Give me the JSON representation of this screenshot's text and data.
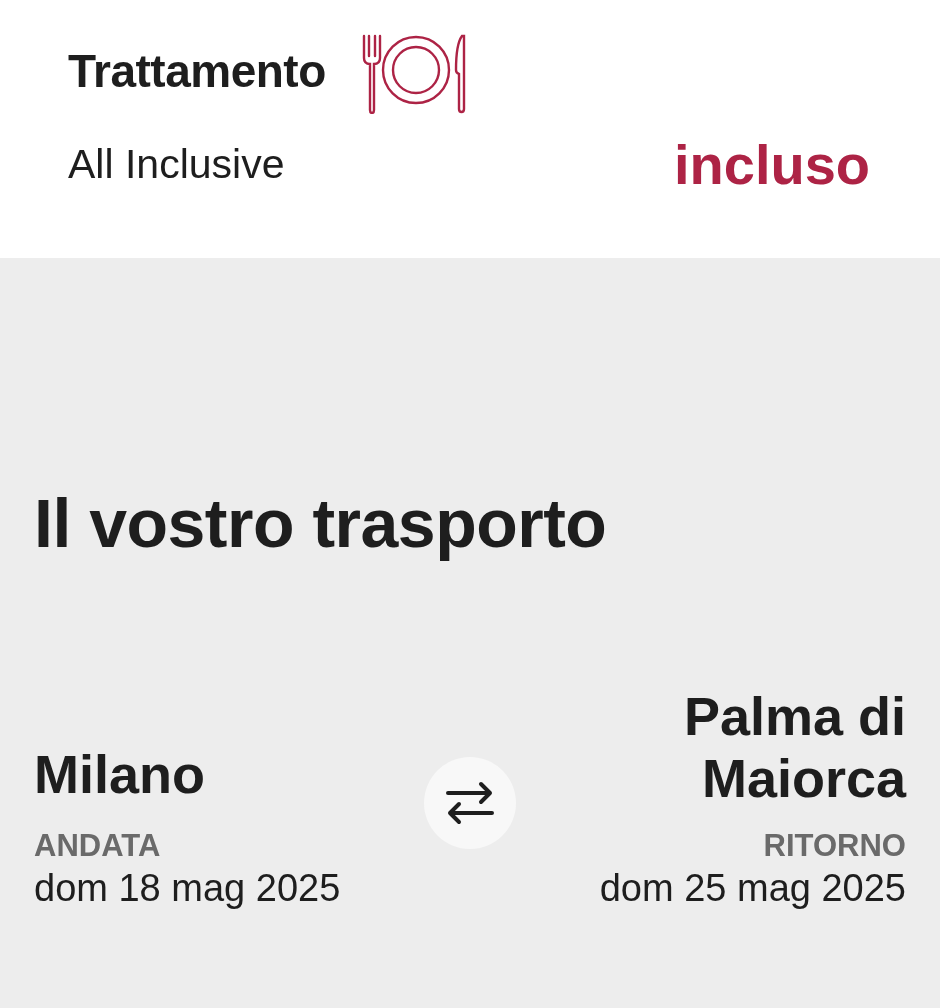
{
  "meal": {
    "title": "Trattamento",
    "board": "All Inclusive",
    "price": "incluso"
  },
  "transport": {
    "title": "Il vostro trasporto",
    "legs": [
      {
        "kind": "outbound",
        "city": "Milano",
        "label": "ANDATA",
        "date": "dom 18 mag 2025"
      },
      {
        "kind": "return",
        "city": "Palma di Maiorca",
        "label": "RITORNO",
        "date": "dom 25 mag 2025"
      }
    ]
  }
}
